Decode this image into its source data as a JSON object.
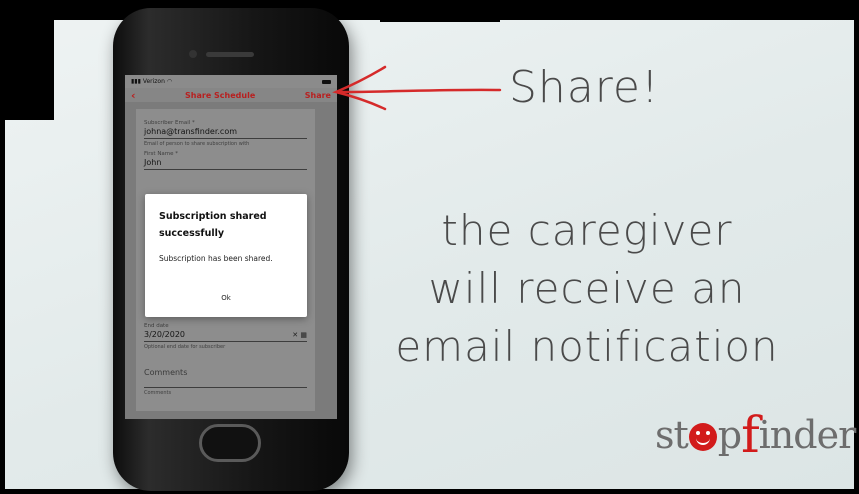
{
  "phone": {
    "status": {
      "carrier": "Verizon",
      "time": ""
    },
    "nav": {
      "back_icon": "chevron-left-icon",
      "title": "Share Schedule",
      "action": "Share"
    },
    "form": {
      "email_label": "Subscriber Email *",
      "email_value": "johna@transfinder.com",
      "email_help": "Email of person to share subscription with",
      "first_name_label": "First Name *",
      "first_name_value": "John",
      "end_date_label": "End date",
      "end_date_value": "3/20/2020",
      "end_date_help": "Optional end date for subscriber",
      "comments_placeholder": "Comments",
      "comments_label": "Comments"
    },
    "modal": {
      "title": "Subscription shared successfully",
      "body": "Subscription has been shared.",
      "ok_label": "Ok"
    }
  },
  "annotations": {
    "share": "Share!",
    "caregiver_line1": "the caregiver",
    "caregiver_line2": "will receive an",
    "caregiver_line3": "email notification"
  },
  "logo": {
    "part1": "st",
    "part2": "p",
    "part3": "f",
    "part4": "inder"
  },
  "colors": {
    "accent": "#d21b1b",
    "ink": "#4a4a4a"
  }
}
